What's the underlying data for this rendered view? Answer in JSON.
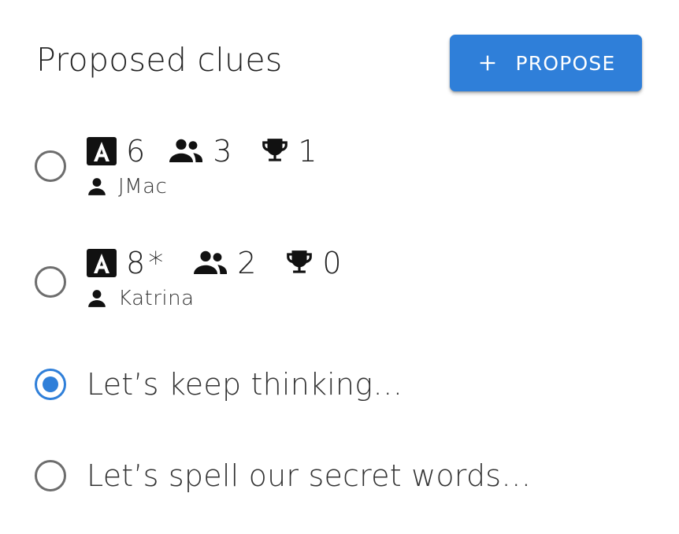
{
  "header": {
    "title": "Proposed clues",
    "propose_button": {
      "label": "PROPOSE",
      "icon": "plus-icon"
    }
  },
  "colors": {
    "accent": "#2f7fd9",
    "radio_unchecked": "#6d6d6d"
  },
  "clues": [
    {
      "letters": "6",
      "letters_flag": "",
      "players": "3",
      "score": "1",
      "author": "JMac",
      "selected": false
    },
    {
      "letters": "8",
      "letters_flag": "*",
      "players": "2",
      "score": "0",
      "author": "Katrina",
      "selected": false
    }
  ],
  "options": [
    {
      "label": "Let’s keep thinking…",
      "selected": true
    },
    {
      "label": "Let’s spell our secret words…",
      "selected": false
    }
  ]
}
